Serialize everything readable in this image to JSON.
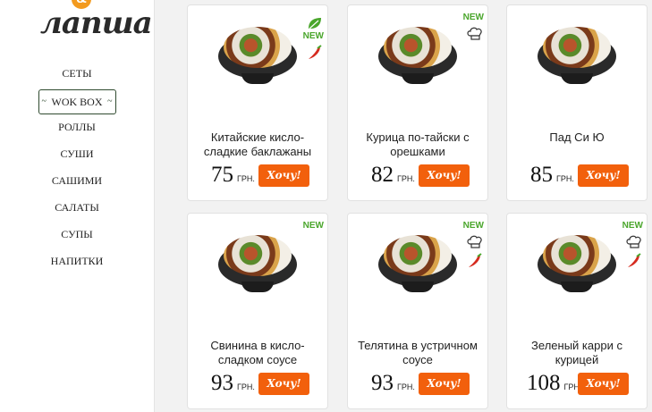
{
  "brand": {
    "logo_text": "лапша",
    "logo_amp": "&"
  },
  "nav": {
    "items": [
      {
        "label": "СЕТЫ"
      },
      {
        "label": "WOK BOX",
        "active": true
      },
      {
        "label": "РОЛЛЫ"
      },
      {
        "label": "СУШИ"
      },
      {
        "label": "САШИМИ"
      },
      {
        "label": "САЛАТЫ"
      },
      {
        "label": "СУПЫ"
      },
      {
        "label": "НАПИТКИ"
      }
    ]
  },
  "products": [
    {
      "title": "Китайские кисло-сладкие баклажаны",
      "price": "75",
      "currency": "ГРН.",
      "button": "Хочу!",
      "badges": [
        "vegan-leaf-icon",
        "new",
        "chili-icon"
      ]
    },
    {
      "title": "Курица по-тайски с орешками",
      "price": "82",
      "currency": "ГРН.",
      "button": "Хочу!",
      "badges": [
        "new",
        "chef-hat-icon"
      ]
    },
    {
      "title": "Пад Си Ю",
      "price": "85",
      "currency": "ГРН.",
      "button": "Хочу!",
      "badges": []
    },
    {
      "title": "Свинина в кисло-сладком соусе",
      "price": "93",
      "currency": "ГРН.",
      "button": "Хочу!",
      "badges": [
        "new"
      ]
    },
    {
      "title": "Телятина в устричном соусе",
      "price": "93",
      "currency": "ГРН.",
      "button": "Хочу!",
      "badges": [
        "new",
        "chef-hat-icon",
        "chili-icon"
      ]
    },
    {
      "title": "Зеленый карри с курицей",
      "price": "108",
      "currency": "ГРН.",
      "button": "Хочу!",
      "badges": [
        "new",
        "chef-hat-icon",
        "chili-icon"
      ]
    }
  ],
  "labels": {
    "new": "NEW"
  },
  "colors": {
    "accent": "#f2600c",
    "new_green": "#4aa62c",
    "chili_red": "#d62b1f"
  }
}
